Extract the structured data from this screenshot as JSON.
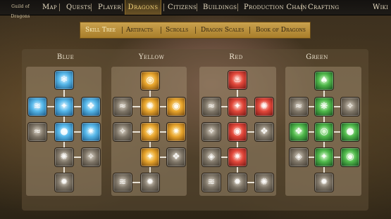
{
  "logo": {
    "text": "Guild of Dragons"
  },
  "nav": {
    "items": [
      {
        "label": "Map"
      },
      {
        "label": "Quests"
      },
      {
        "label": "Player"
      },
      {
        "label": "Dragons"
      },
      {
        "label": "Citizens"
      },
      {
        "label": "Buildings"
      },
      {
        "label": "Production Chain"
      },
      {
        "label": "Crafting"
      }
    ],
    "active": "Dragons",
    "wiki": "Wiki"
  },
  "subnav": {
    "items": [
      {
        "label": "Skill Tree"
      },
      {
        "label": "Artifacts"
      },
      {
        "label": "Scrolls"
      },
      {
        "label": "Dragon Scales"
      },
      {
        "label": "Book of Dragons"
      }
    ],
    "active": "Skill Tree"
  },
  "colors": {
    "blue": "#57b8ea",
    "yellow": "#e8a52c",
    "red": "#e2473a",
    "green": "#4fb84a",
    "accent": "#c9a04c"
  },
  "columns": [
    {
      "title": "Blue",
      "skills": [
        {
          "state": "unlocked",
          "icon": "ice-shard-icon"
        },
        {
          "state": "unlocked",
          "icon": "frost-wave-icon"
        },
        {
          "state": "unlocked",
          "icon": "frost-claw-icon"
        },
        {
          "state": "unlocked",
          "icon": "ice-wings-icon"
        },
        {
          "state": "locked",
          "icon": "wind-gust-icon"
        },
        {
          "state": "unlocked",
          "icon": "frost-orb-icon"
        },
        {
          "state": "unlocked",
          "icon": "blizzard-icon"
        },
        {
          "state": "locked",
          "icon": "ground-burst-icon"
        },
        {
          "state": "locked",
          "icon": "shadow-claw-icon"
        },
        {
          "state": "locked",
          "icon": "tornado-icon"
        }
      ]
    },
    {
      "title": "Yellow",
      "skills": [
        {
          "state": "unlocked",
          "icon": "sun-swirl-icon"
        },
        {
          "state": "locked",
          "icon": "claw-slash-icon"
        },
        {
          "state": "unlocked",
          "icon": "solar-flare-icon"
        },
        {
          "state": "unlocked",
          "icon": "fire-swirl-icon"
        },
        {
          "state": "locked",
          "icon": "tail-whip-icon"
        },
        {
          "state": "unlocked",
          "icon": "golden-shield-icon"
        },
        {
          "state": "unlocked",
          "icon": "sun-burst-icon"
        },
        {
          "state": "unlocked",
          "icon": "golden-fang-icon"
        },
        {
          "state": "locked",
          "icon": "wing-sweep-icon"
        },
        {
          "state": "locked",
          "icon": "gale-icon"
        },
        {
          "state": "locked",
          "icon": "radiance-icon"
        }
      ]
    },
    {
      "title": "Red",
      "skills": [
        {
          "state": "unlocked",
          "icon": "flame-crown-icon"
        },
        {
          "state": "locked",
          "icon": "ember-slash-icon"
        },
        {
          "state": "unlocked",
          "icon": "fire-claw-icon"
        },
        {
          "state": "unlocked",
          "icon": "fire-breath-icon"
        },
        {
          "state": "locked",
          "icon": "smoke-icon"
        },
        {
          "state": "unlocked",
          "icon": "inferno-icon"
        },
        {
          "state": "locked",
          "icon": "ash-icon"
        },
        {
          "state": "locked",
          "icon": "stone-fist-icon"
        },
        {
          "state": "unlocked",
          "icon": "blaze-icon"
        },
        {
          "state": "locked",
          "icon": "ground-crack-icon"
        },
        {
          "state": "locked",
          "icon": "eruption-icon"
        },
        {
          "state": "locked",
          "icon": "cinder-icon"
        }
      ]
    },
    {
      "title": "Green",
      "skills": [
        {
          "state": "unlocked",
          "icon": "poison-drop-icon"
        },
        {
          "state": "locked",
          "icon": "thorn-icon"
        },
        {
          "state": "unlocked",
          "icon": "venom-claw-icon"
        },
        {
          "state": "locked",
          "icon": "moss-icon"
        },
        {
          "state": "unlocked",
          "icon": "leaf-wings-icon"
        },
        {
          "state": "unlocked",
          "icon": "vortex-icon"
        },
        {
          "state": "unlocked",
          "icon": "spore-orb-icon"
        },
        {
          "state": "locked",
          "icon": "bark-skin-icon"
        },
        {
          "state": "unlocked",
          "icon": "vine-whip-icon"
        },
        {
          "state": "unlocked",
          "icon": "toxic-cloud-icon"
        },
        {
          "state": "locked",
          "icon": "root-strike-icon"
        }
      ]
    }
  ]
}
